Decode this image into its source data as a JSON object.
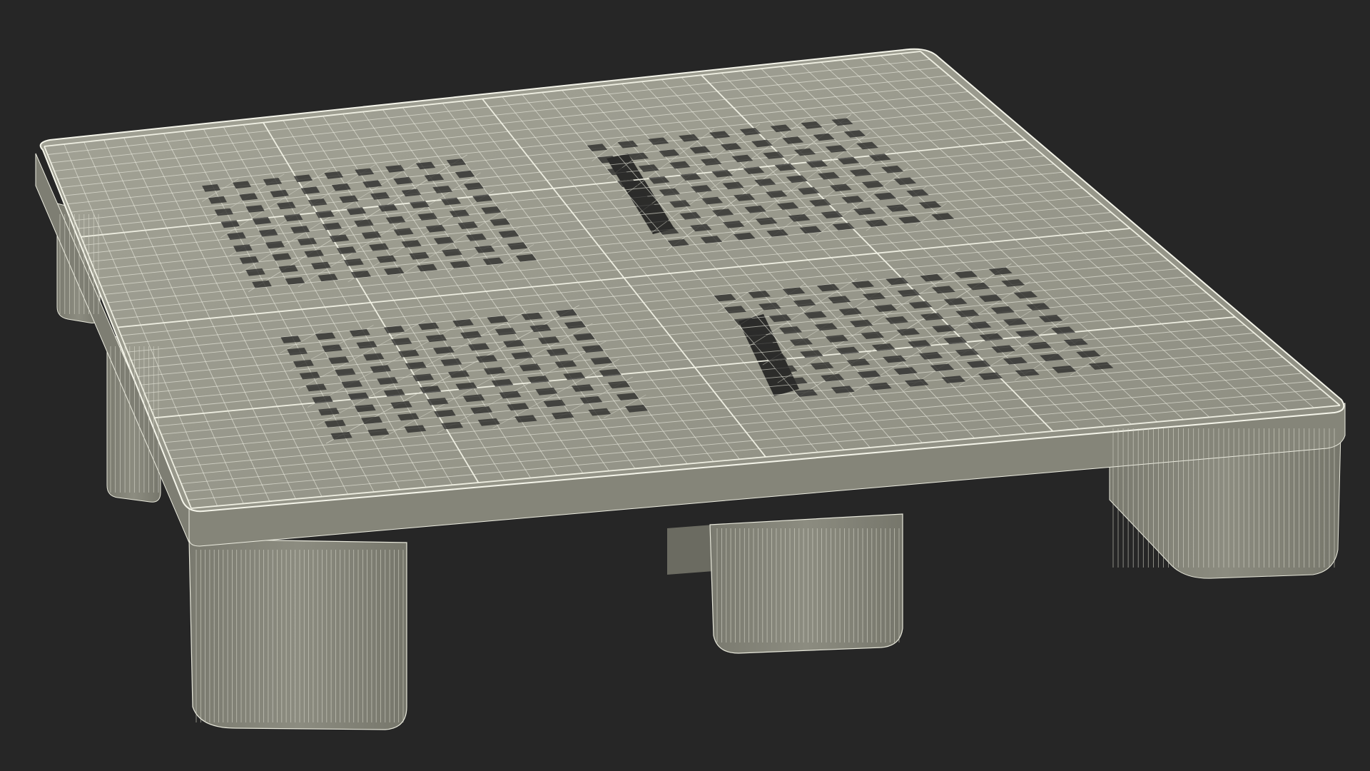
{
  "scene": {
    "subject": "plastic-pallet-wireframe",
    "render_style": "wireframe",
    "background_color": "#262626",
    "surface_color": "#8e8e82",
    "surface_shadow_color": "#6f6f65",
    "surface_light_color": "#a9a99c",
    "wire_color": "#f2f2e6",
    "wire_soft_color": "#d9d9cc",
    "hole_color": "#2c2c2a"
  }
}
